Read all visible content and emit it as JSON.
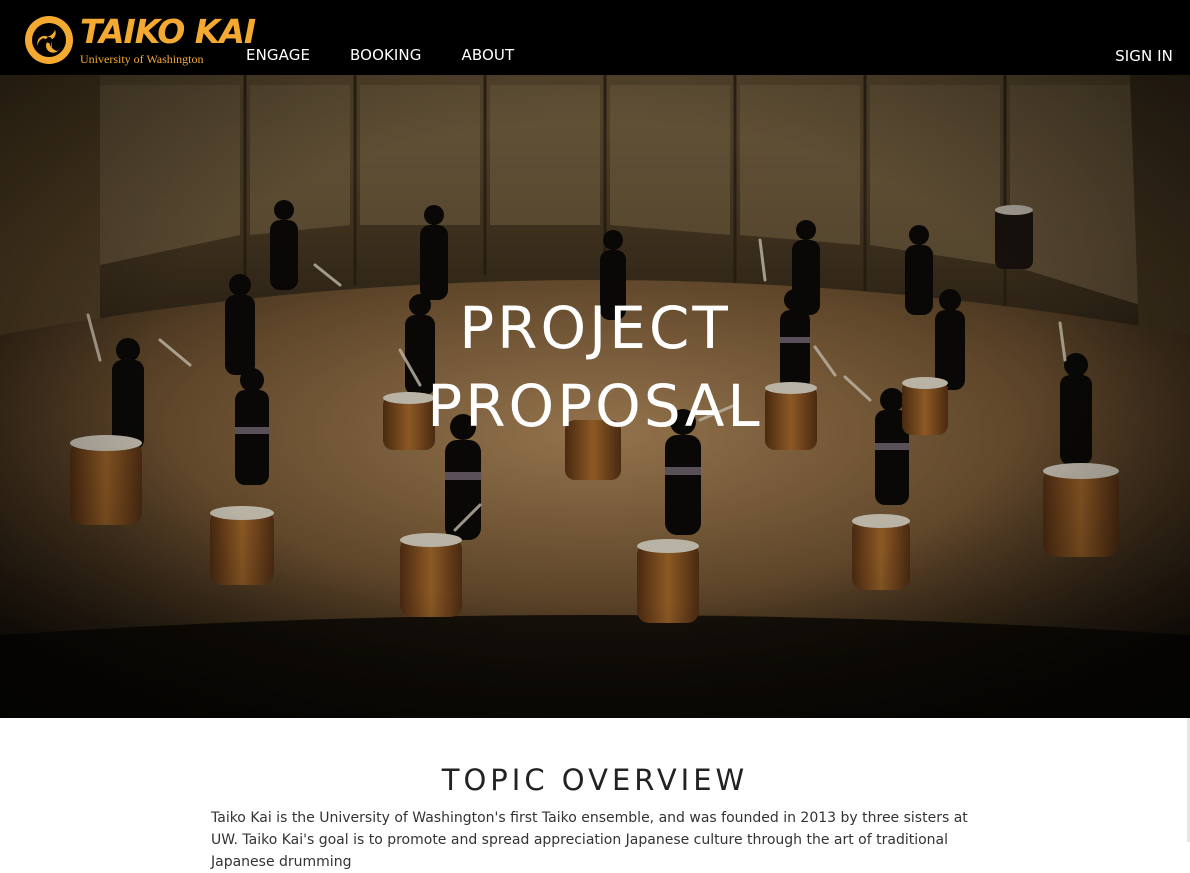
{
  "brand": {
    "name": "TAIKO KAI",
    "subtitle": "University of Washington",
    "accent_color": "#f4a930"
  },
  "nav": {
    "items": [
      {
        "label": "ENGAGE"
      },
      {
        "label": "BOOKING"
      },
      {
        "label": "ABOUT"
      }
    ],
    "signin_label": "SIGN IN"
  },
  "hero": {
    "title_line1": "PROJECT",
    "title_line2": "PROPOSAL",
    "image": "taiko-drummers-performing-on-stage"
  },
  "overview": {
    "heading": "TOPIC OVERVIEW",
    "body": "Taiko Kai is the University of Washington's first Taiko ensemble, and was founded in 2013 by three sisters at UW. Taiko Kai's goal is to promote and spread appreciation Japanese culture through the art of traditional Japanese drumming"
  },
  "colors": {
    "header_bg": "#000000",
    "text_dark": "#222222",
    "page_bg": "#ffffff"
  }
}
